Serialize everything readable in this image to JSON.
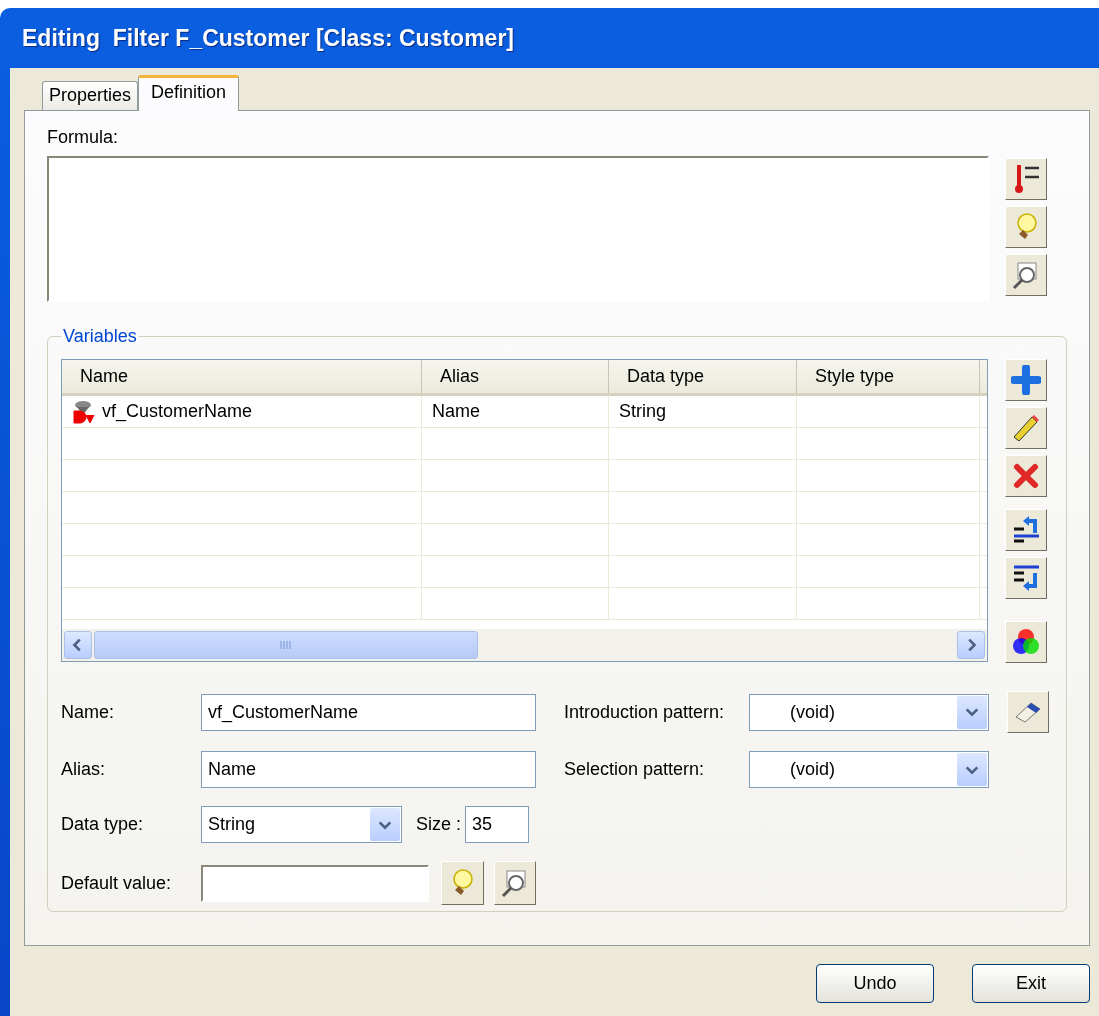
{
  "window": {
    "title": "Editing  Filter F_Customer [Class: Customer]"
  },
  "tabs": [
    {
      "label": "Properties",
      "selected": false
    },
    {
      "label": "Definition",
      "selected": true
    }
  ],
  "formula": {
    "label": "Formula:"
  },
  "variables": {
    "title": "Variables",
    "columns": [
      "Name",
      "Alias",
      "Data type",
      "Style type"
    ],
    "rows": [
      {
        "cells": [
          "vf_CustomerName",
          "Name",
          "String",
          ""
        ]
      }
    ]
  },
  "form": {
    "name": {
      "label": "Name:",
      "value": "vf_CustomerName"
    },
    "alias": {
      "label": "Alias:",
      "value": "Name"
    },
    "data_type": {
      "label": "Data type:",
      "value": "String"
    },
    "size": {
      "label": "Size :",
      "value": "35"
    },
    "default_value": {
      "label": "Default value:"
    },
    "introduction_pattern": {
      "label": "Introduction pattern:",
      "value": "(void)"
    },
    "selection_pattern": {
      "label": "Selection pattern:",
      "value": "(void)"
    }
  },
  "buttons": [
    "Undo",
    "Exit"
  ]
}
